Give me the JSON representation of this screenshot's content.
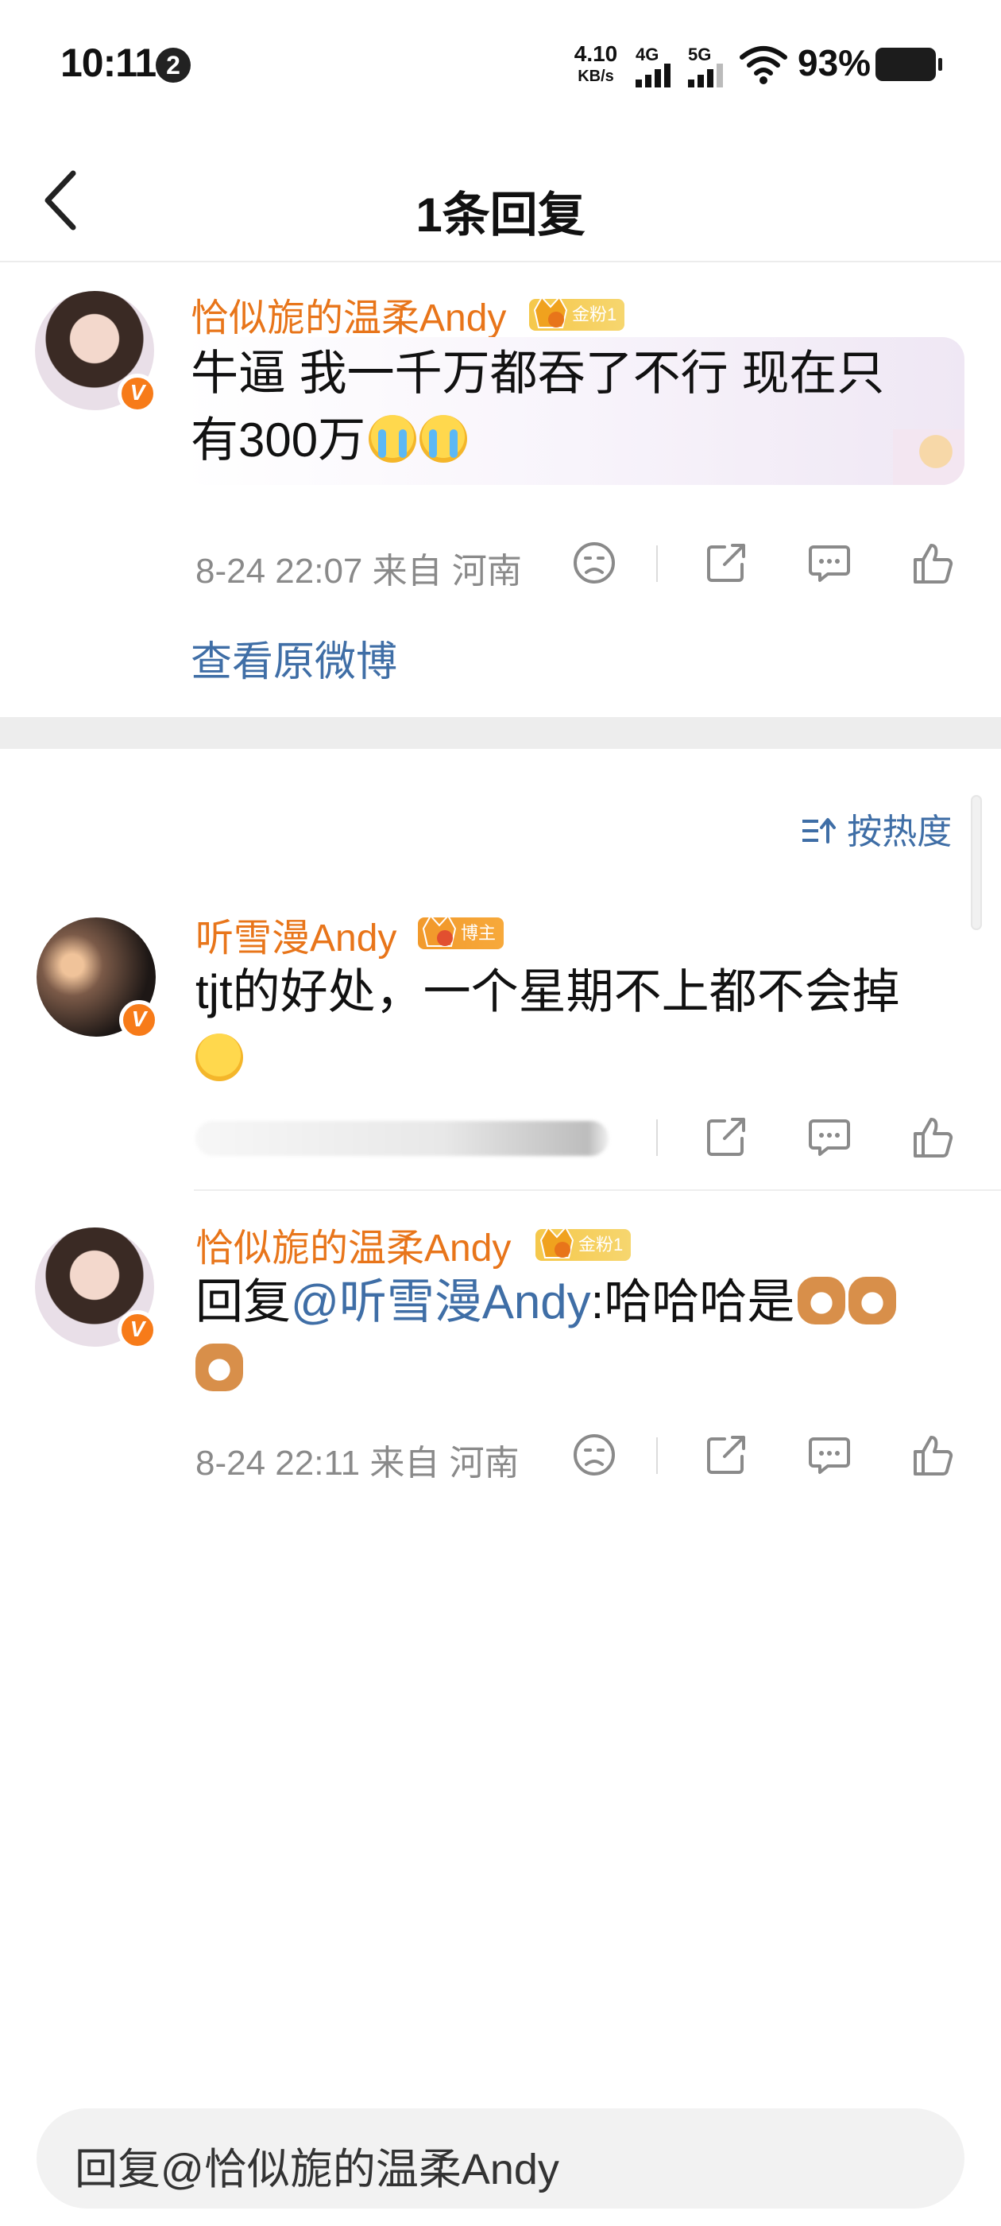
{
  "status_bar": {
    "time": "10:11",
    "notification_count": "2",
    "net_speed_value": "4.10",
    "net_speed_unit": "KB/s",
    "signal_1_label": "4G",
    "signal_2_label": "5G",
    "battery_percent": "93%"
  },
  "header": {
    "title": "1条回复"
  },
  "root_comment": {
    "username": "恰似旎的温柔Andy",
    "badge_level": "6",
    "badge_text": "金粉1",
    "content_line1": "牛逼 我一千万都吞了不行 现在只",
    "content_line2": "有300万",
    "meta": "8-24 22:07 来自 河南",
    "view_original": "查看原微博"
  },
  "sort": {
    "label": "按热度"
  },
  "replies": [
    {
      "username": "听雪漫Andy",
      "badge_level": "3",
      "badge_text": "博主",
      "content_line1": "tjt的好处，一个星期不上都不会掉"
    },
    {
      "username": "恰似旎的温柔Andy",
      "badge_level": "6",
      "badge_text": "金粉1",
      "reply_prefix": "回复",
      "mention": "@听雪漫Andy",
      "content_text": ":哈哈哈是",
      "meta": "8-24 22:11 来自 河南"
    }
  ],
  "reply_bar": {
    "placeholder": "回复@恰似旎的温柔Andy"
  },
  "colors": {
    "username": "#e8751a",
    "link": "#3f6ea6",
    "meta": "#8a8a8a",
    "verified_badge": "#f77b19"
  },
  "icons": [
    "back-arrow-icon",
    "dislike-face-icon",
    "share-icon",
    "comment-icon",
    "like-icon",
    "sort-icon",
    "wifi-icon",
    "battery-icon"
  ]
}
